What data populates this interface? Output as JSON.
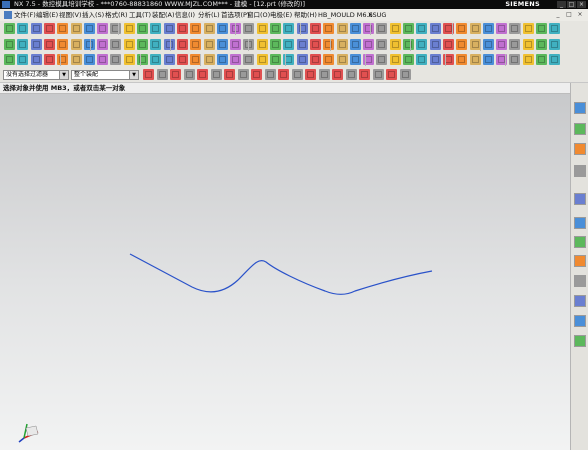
{
  "window": {
    "title": "NX 7.5 - 数控模具培训学校 - ***0760-88831860 WWW.MJZL.COM*** - 建模 - [12.prt (修改的)]",
    "brand": "SIEMENS",
    "controls": [
      "_",
      "□",
      "×"
    ]
  },
  "menu": {
    "items": [
      "文件(F)",
      "编辑(E)",
      "视图(V)",
      "插入(S)",
      "格式(R)",
      "工具(T)",
      "装配(A)",
      "信息(I)",
      "分析(L)",
      "首选项(P)",
      "窗口(O)",
      "电极(E)",
      "帮助(H)",
      "HB_MOULD M6.6",
      "XSUG"
    ],
    "controls": [
      "_",
      "□",
      "×"
    ]
  },
  "filter": {
    "selection_filter": "没有选择过滤器",
    "scope": "整个装配"
  },
  "cue_line": "选择对象并使用 MB3，或者双击某一对象",
  "colors": {
    "curve": "#2a52c9",
    "accent": "#f0c030"
  }
}
